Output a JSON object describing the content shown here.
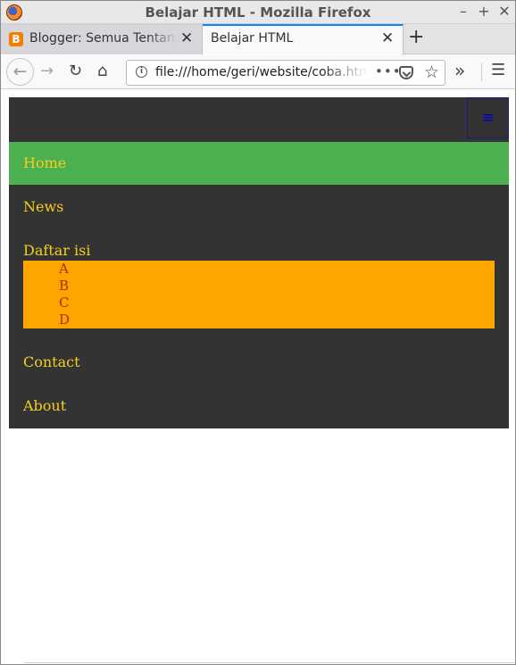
{
  "window": {
    "title": "Belajar HTML - Mozilla Firefox",
    "controls": {
      "minimize": "–",
      "maximize": "+",
      "close": "✕"
    }
  },
  "tabs": [
    {
      "label": "Blogger: Semua Tentang Blog",
      "favicon_letter": "B",
      "close": "✕",
      "active": false
    },
    {
      "label": "Belajar HTML",
      "close": "✕",
      "active": true
    }
  ],
  "new_tab": "+",
  "navbar": {
    "back": "←",
    "forward": "→",
    "reload": "↻",
    "home": "⌂",
    "url": "file:///home/geri/website/coba.html",
    "info": "i",
    "page_actions": "•••",
    "star": "☆",
    "overflow": "»",
    "menu": "☰"
  },
  "site_nav": {
    "toggle_icon": "≡",
    "links": {
      "home": "Home",
      "news": "News",
      "daftar_isi": "Daftar isi",
      "contact": "Contact",
      "about": "About"
    },
    "submenu": [
      "A",
      "B",
      "C",
      "D"
    ],
    "colors": {
      "nav_bg": "#333333",
      "active_bg": "#4caf50",
      "link_text": "#f4d01c",
      "submenu_bg": "#ffa500",
      "submenu_text": "#b22a00",
      "toggle": "#0000cc"
    }
  }
}
